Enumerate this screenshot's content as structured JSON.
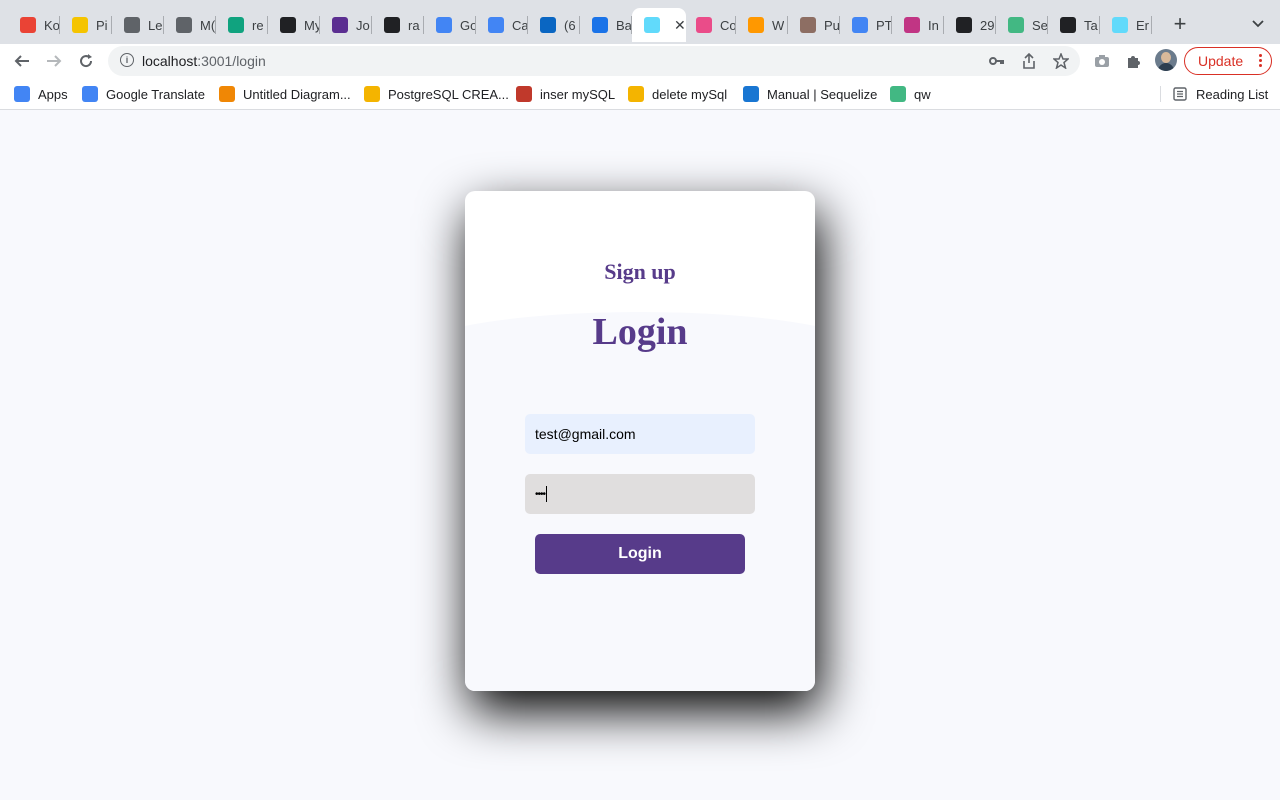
{
  "browser": {
    "tabs": [
      {
        "title": "Ko",
        "icon": "gmail-icon",
        "color": "#ea4335"
      },
      {
        "title": "Pi",
        "icon": "pi-icon",
        "color": "#f5c400"
      },
      {
        "title": "Le",
        "icon": "globe-icon",
        "color": "#5f6368"
      },
      {
        "title": "M(",
        "icon": "globe-icon",
        "color": "#5f6368"
      },
      {
        "title": "re",
        "icon": "chatgpt-icon",
        "color": "#10a37f"
      },
      {
        "title": "My",
        "icon": "star-icon",
        "color": "#202124"
      },
      {
        "title": "Jo",
        "icon": "jo-icon",
        "color": "#5b2e91"
      },
      {
        "title": "ra",
        "icon": "github-icon",
        "color": "#202124"
      },
      {
        "title": "Go",
        "icon": "google-translate-icon",
        "color": "#4285f4"
      },
      {
        "title": "Ca",
        "icon": "docs-icon",
        "color": "#4285f4"
      },
      {
        "title": "(6",
        "icon": "linkedin-icon",
        "color": "#0a66c2"
      },
      {
        "title": "Ba",
        "icon": "k-icon",
        "color": "#1a73e8"
      },
      {
        "title": "",
        "icon": "react-icon",
        "color": "#61dafb",
        "active": true
      },
      {
        "title": "Co",
        "icon": "dribbble-icon",
        "color": "#ea4c89"
      },
      {
        "title": "W",
        "icon": "w-icon",
        "color": "#ff9800"
      },
      {
        "title": "Pu",
        "icon": "puzzle-icon",
        "color": "#8d6e63"
      },
      {
        "title": "PT",
        "icon": "google-icon",
        "color": "#4285f4"
      },
      {
        "title": "In",
        "icon": "instagram-icon",
        "color": "#c13584"
      },
      {
        "title": "29",
        "icon": "f-icon",
        "color": "#202124"
      },
      {
        "title": "Se",
        "icon": "vue-icon",
        "color": "#42b883"
      },
      {
        "title": "Ta",
        "icon": "st-icon",
        "color": "#202124"
      },
      {
        "title": "Er",
        "icon": "react-icon",
        "color": "#61dafb"
      }
    ],
    "url_host": "localhost",
    "url_path": ":3001/login",
    "update_label": "Update",
    "bookmarks": [
      {
        "label": "Apps",
        "icon": "apps-grid-icon",
        "color": "#4285f4"
      },
      {
        "label": "Google Translate",
        "icon": "google-translate-icon",
        "color": "#4285f4"
      },
      {
        "label": "Untitled Diagram...",
        "icon": "drawio-icon",
        "color": "#f08705"
      },
      {
        "label": "PostgreSQL CREA...",
        "icon": "postgresql-icon",
        "color": "#f4b400"
      },
      {
        "label": "inser mySQL",
        "icon": "mysql-icon",
        "color": "#c0392b"
      },
      {
        "label": "delete mySql",
        "icon": "mysql-delete-icon",
        "color": "#f4b400"
      },
      {
        "label": "Manual | Sequelize",
        "icon": "sequelize-icon",
        "color": "#1976d2"
      },
      {
        "label": "qw",
        "icon": "vue-icon",
        "color": "#42b883"
      }
    ],
    "reading_list_label": "Reading List"
  },
  "page": {
    "signup_label": "Sign up",
    "login_label": "Login",
    "email_value": "test@gmail.com",
    "password_value": "••••",
    "login_button_label": "Login",
    "accent_color": "#573b8a"
  }
}
